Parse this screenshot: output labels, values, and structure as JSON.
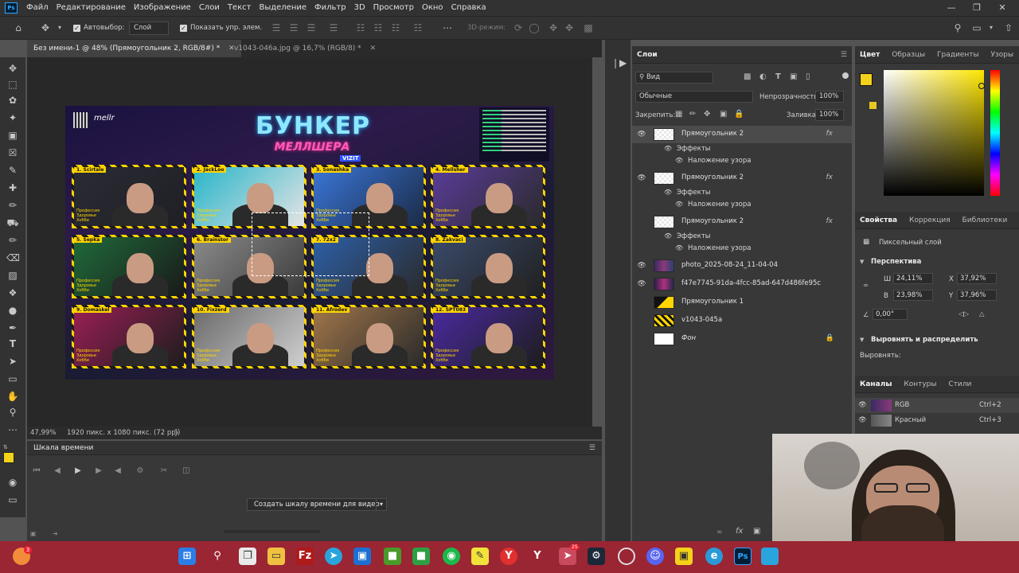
{
  "app": {
    "logo": "Ps",
    "menu": [
      "Файл",
      "Редактирование",
      "Изображение",
      "Слои",
      "Текст",
      "Выделение",
      "Фильтр",
      "3D",
      "Просмотр",
      "Окно",
      "Справка"
    ]
  },
  "options": {
    "autoselect_label": "Автовыбор:",
    "autoselect_value": "Слой",
    "show_controls_label": "Показать упр. элем.",
    "mode_3d_label": "3D-режим:"
  },
  "documents": {
    "tabs": [
      {
        "title": "Без имени-1 @ 48% (Прямоугольник 2, RGB/8#) *",
        "active": true
      },
      {
        "title": "v1043-046a.jpg @ 16,7% (RGB/8) *",
        "active": false
      }
    ]
  },
  "status": {
    "zoom": "47,99%",
    "info": "1920 пикс. x 1080 пикс. (72 ppi)"
  },
  "artwork": {
    "title": "БУНКЕР",
    "subtitle": "МЕЛЛШЕРА",
    "badge": "VIZIT",
    "logo_text": "mellr",
    "players": [
      {
        "tag": "1. Scirtale"
      },
      {
        "tag": "2. JackLoo"
      },
      {
        "tag": "3. Sonashka"
      },
      {
        "tag": "4. Mellsher"
      },
      {
        "tag": "5. Sepka"
      },
      {
        "tag": "6. Brainstor"
      },
      {
        "tag": "7. 72x2"
      },
      {
        "tag": "8. Zakvaci"
      },
      {
        "tag": "9. Domaskel"
      },
      {
        "tag": "10. Fixzerd"
      },
      {
        "tag": "11. Afrodev"
      },
      {
        "tag": "12. SPT083"
      }
    ],
    "card_info": "Профессия\nЗдоровье\nХобби"
  },
  "timeline": {
    "title": "Шкала времени",
    "create_button": "Создать шкалу времени для видео"
  },
  "layers": {
    "panel_title": "Слои",
    "filter_value": "Вид",
    "blend_mode": "Обычные",
    "opacity_label": "Непрозрачность:",
    "opacity_value": "100%",
    "lock_label": "Закрепить:",
    "fill_label": "Заливка:",
    "fill_value": "100%",
    "effects_label": "Эффекты",
    "pattern_overlay_label": "Наложение узора",
    "items": [
      {
        "name": "Прямоугольник 2",
        "fx": "fx",
        "visible": true,
        "selected": true
      },
      {
        "name": "Прямоугольник 2",
        "fx": "fx",
        "visible": true,
        "selected": false
      },
      {
        "name": "Прямоугольник 2",
        "fx": "fx",
        "visible": false,
        "selected": false
      },
      {
        "name": "photo_2025-08-24_11-04-04",
        "visible": true
      },
      {
        "name": "f47e7745-91da-4fcc-85ad-647d486fe95c",
        "visible": true
      },
      {
        "name": "Прямоугольник 1",
        "visible": false
      },
      {
        "name": "v1043-045a",
        "visible": false
      },
      {
        "name": "Фон",
        "visible": false,
        "locked": true
      }
    ]
  },
  "color_panel": {
    "tabs": [
      "Цвет",
      "Образцы",
      "Градиенты",
      "Узоры"
    ],
    "foreground": "#f5d21a",
    "background": "#ffffff"
  },
  "properties": {
    "tabs": [
      "Свойства",
      "Коррекция",
      "Библиотеки"
    ],
    "layer_type": "Пиксельный слой",
    "section_perspective": "Перспектива",
    "w_label": "Ш",
    "w_value": "24,11%",
    "h_label": "В",
    "h_value": "23,98%",
    "x_label": "X",
    "x_value": "37,92%",
    "y_label": "Y",
    "y_value": "37,96%",
    "angle_value": "0,00°",
    "section_align": "Выровнять и распределить",
    "align_label": "Выровнять:"
  },
  "channels": {
    "tabs": [
      "Каналы",
      "Контуры",
      "Стили"
    ],
    "items": [
      {
        "name": "RGB",
        "shortcut": "Ctrl+2"
      },
      {
        "name": "Красный",
        "shortcut": "Ctrl+3"
      }
    ]
  },
  "taskbar": {
    "notification_badge": "3",
    "telegram_badge": "25"
  },
  "colors": {
    "accent_yellow": "#ffd400",
    "ps_blue": "#31a8ff",
    "taskbar": "#9a2533"
  }
}
